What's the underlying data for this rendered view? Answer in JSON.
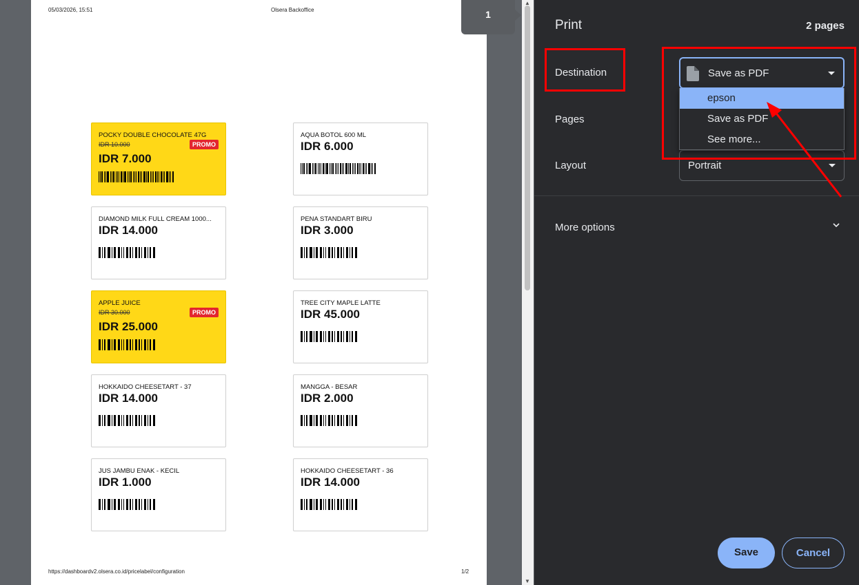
{
  "preview": {
    "header_date": "05/03/2026, 15:51",
    "header_title": "Olsera Backoffice",
    "footer_url": "https://dashboardv2.olsera.co.id/pricelabel/configuration",
    "footer_page": "1/2",
    "page_tab": "1",
    "labels": [
      {
        "name": "POCKY DOUBLE CHOCOLATE 47G",
        "old_price": "IDR 10.000",
        "price": "IDR 7.000",
        "promo": "PROMO"
      },
      {
        "name": "AQUA BOTOL 600 ML",
        "old_price": "",
        "price": "IDR 6.000",
        "promo": ""
      },
      {
        "name": "DIAMOND MILK FULL CREAM 1000...",
        "old_price": "",
        "price": "IDR 14.000",
        "promo": ""
      },
      {
        "name": "PENA STANDART BIRU",
        "old_price": "",
        "price": "IDR 3.000",
        "promo": ""
      },
      {
        "name": "APPLE JUICE",
        "old_price": "IDR 30.000",
        "price": "IDR 25.000",
        "promo": "PROMO"
      },
      {
        "name": "TREE CITY MAPLE LATTE",
        "old_price": "",
        "price": "IDR 45.000",
        "promo": ""
      },
      {
        "name": "HOKKAIDO CHEESETART - 37",
        "old_price": "",
        "price": "IDR 14.000",
        "promo": ""
      },
      {
        "name": "MANGGA - BESAR",
        "old_price": "",
        "price": "IDR 2.000",
        "promo": ""
      },
      {
        "name": "JUS JAMBU ENAK - KECIL",
        "old_price": "",
        "price": "IDR 1.000",
        "promo": ""
      },
      {
        "name": "HOKKAIDO CHEESETART - 36",
        "old_price": "",
        "price": "IDR 14.000",
        "promo": ""
      }
    ]
  },
  "panel": {
    "title": "Print",
    "page_count": "2 pages",
    "destination_label": "Destination",
    "destination_value": "Save as PDF",
    "destination_options": [
      "epson",
      "Save as PDF",
      "See more..."
    ],
    "highlighted_option": "epson",
    "pages_label": "Pages",
    "layout_label": "Layout",
    "layout_value": "Portrait",
    "more_options": "More options",
    "save_button": "Save",
    "cancel_button": "Cancel"
  },
  "colors": {
    "panel_bg": "#292a2d",
    "accent": "#8ab4f8",
    "promo_bg": "#ffd817",
    "promo_badge": "#e3262e",
    "annotation": "#ff0000"
  }
}
